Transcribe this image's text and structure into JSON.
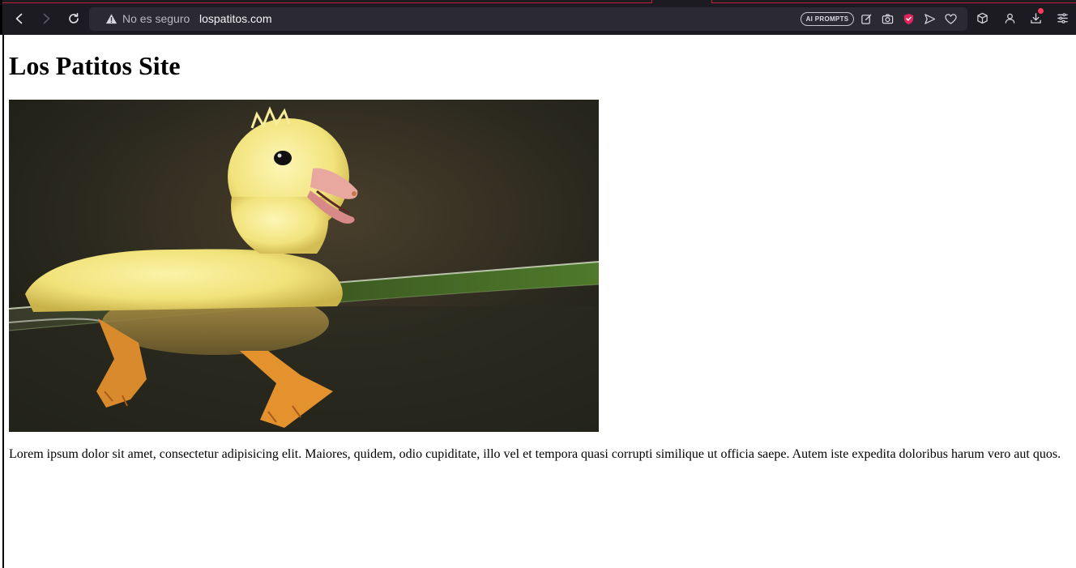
{
  "browser": {
    "insecure_label": "No es seguro",
    "url": "lospatitos.com",
    "ai_button_label": "AI PROMPTS",
    "icons": {
      "back": "back-arrow-icon",
      "forward": "forward-arrow-icon",
      "reload": "reload-icon",
      "warning": "warning-triangle-icon",
      "edit": "edit-icon",
      "screenshot": "camera-icon",
      "shield": "shield-icon",
      "send": "send-icon",
      "favorite": "heart-icon",
      "extensions": "cube-icon",
      "account": "person-icon",
      "download": "download-icon",
      "menu": "menu-icon"
    },
    "colors": {
      "toolbar_bg": "#1c1b22",
      "urlbar_bg": "#2b2a33",
      "accent": "#c5203d",
      "shield": "#e0245e",
      "download_badge": "#ff3b5b"
    }
  },
  "page": {
    "title": "Los Patitos Site",
    "image_subject": "duckling swimming",
    "paragraph": "Lorem ipsum dolor sit amet, consectetur adipisicing elit. Maiores, quidem, odio cupiditate, illo vel et tempora quasi corrupti similique ut officia saepe. Autem iste expedita doloribus harum vero aut quos."
  }
}
